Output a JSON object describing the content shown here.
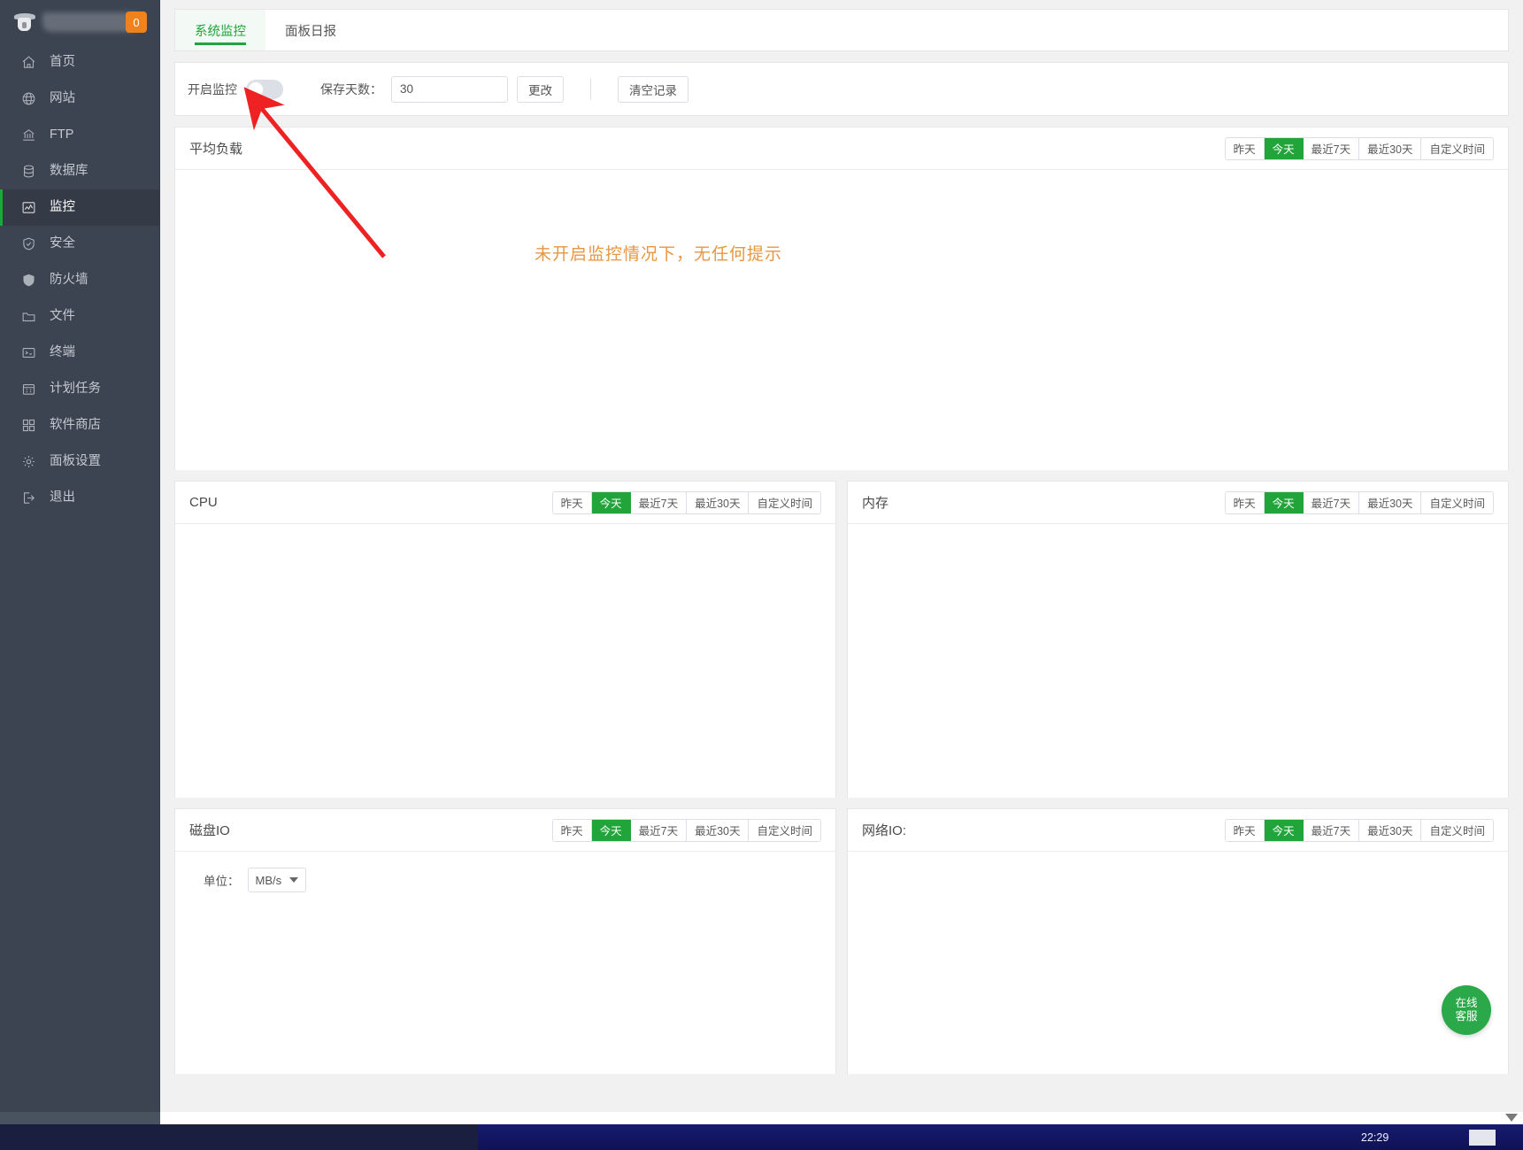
{
  "sidebar": {
    "badge": "0",
    "items": [
      {
        "label": "首页",
        "icon": "home-icon",
        "active": false
      },
      {
        "label": "网站",
        "icon": "globe-icon",
        "active": false
      },
      {
        "label": "FTP",
        "icon": "ftp-icon",
        "active": false
      },
      {
        "label": "数据库",
        "icon": "database-icon",
        "active": false
      },
      {
        "label": "监控",
        "icon": "monitor-icon",
        "active": true
      },
      {
        "label": "安全",
        "icon": "shield-check-icon",
        "active": false
      },
      {
        "label": "防火墙",
        "icon": "shield-filled-icon",
        "active": false
      },
      {
        "label": "文件",
        "icon": "folder-icon",
        "active": false
      },
      {
        "label": "终端",
        "icon": "terminal-icon",
        "active": false
      },
      {
        "label": "计划任务",
        "icon": "calendar-icon",
        "active": false
      },
      {
        "label": "软件商店",
        "icon": "grid-icon",
        "active": false
      },
      {
        "label": "面板设置",
        "icon": "gear-icon",
        "active": false
      },
      {
        "label": "退出",
        "icon": "logout-icon",
        "active": false
      }
    ]
  },
  "tabs": [
    {
      "label": "系统监控",
      "active": true
    },
    {
      "label": "面板日报",
      "active": false
    }
  ],
  "toolbar": {
    "monitor_switch_label": "开启监控",
    "switch_state": "off",
    "keep_days_label": "保存天数：",
    "keep_days_value": "30",
    "change_button": "更改",
    "clear_button": "清空记录"
  },
  "panels": {
    "load": {
      "title": "平均负载",
      "ranges": [
        "昨天",
        "今天",
        "最近7天",
        "最近30天",
        "自定义时间"
      ],
      "active_range": "今天"
    },
    "cpu": {
      "title": "CPU",
      "ranges": [
        "昨天",
        "今天",
        "最近7天",
        "最近30天",
        "自定义时间"
      ],
      "active_range": "今天"
    },
    "memory": {
      "title": "内存",
      "ranges": [
        "昨天",
        "今天",
        "最近7天",
        "最近30天",
        "自定义时间"
      ],
      "active_range": "今天"
    },
    "disk_io": {
      "title": "磁盘IO",
      "ranges": [
        "昨天",
        "今天",
        "最近7天",
        "最近30天",
        "自定义时间"
      ],
      "active_range": "今天",
      "unit_label": "单位：",
      "unit_value": "MB/s"
    },
    "network_io": {
      "title": "网络IO:",
      "ranges": [
        "昨天",
        "今天",
        "最近7天",
        "最近30天",
        "自定义时间"
      ],
      "active_range": "今天"
    }
  },
  "annotation": {
    "text": "未开启监控情况下，无任何提示",
    "color": "#e8963f",
    "arrow_color": "#ee2222"
  },
  "service_fab": {
    "line1": "在线",
    "line2": "客服"
  },
  "taskbar": {
    "clock": "22:29"
  },
  "colors": {
    "accent_green": "#20a53a",
    "badge_orange": "#f0821e",
    "sidebar_bg": "#3c4452"
  }
}
